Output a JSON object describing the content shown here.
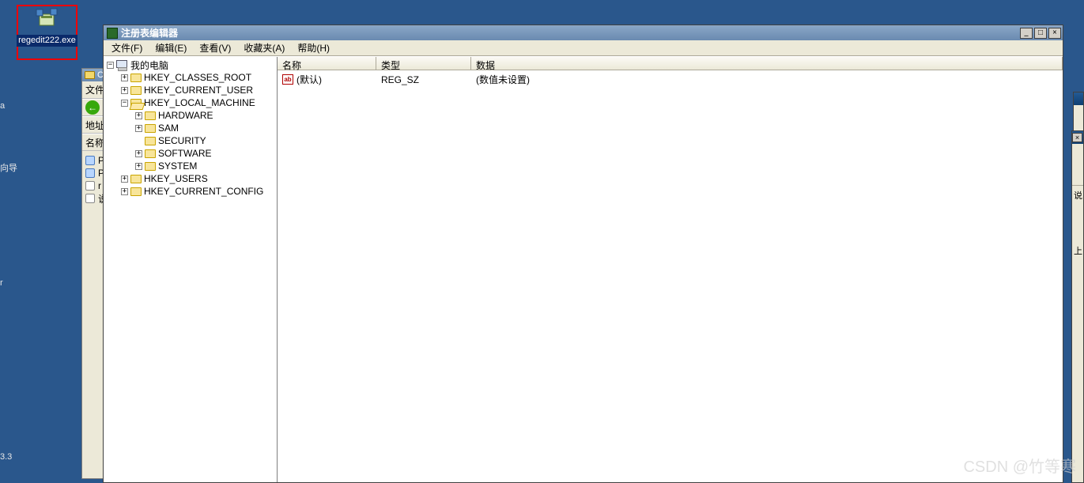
{
  "desktop_icon": {
    "label": "regedit222.exe"
  },
  "left_texts": {
    "a": "向导",
    "b": "3.3"
  },
  "bgwin": {
    "title": "C",
    "toolbar_file": "文件",
    "back_label": "后",
    "addr_label": "地址",
    "name_label": "名称",
    "rows": [
      "P",
      "P",
      "r",
      "说"
    ]
  },
  "regedit": {
    "title": "注册表编辑器",
    "menu": {
      "file": "文件(F)",
      "edit": "编辑(E)",
      "view": "查看(V)",
      "fav": "收藏夹(A)",
      "help": "帮助(H)"
    },
    "tree": {
      "root": "我的电脑",
      "nodes": [
        {
          "name": "HKEY_CLASSES_ROOT",
          "expanded": false,
          "depth": 1
        },
        {
          "name": "HKEY_CURRENT_USER",
          "expanded": false,
          "depth": 1
        },
        {
          "name": "HKEY_LOCAL_MACHINE",
          "expanded": true,
          "depth": 1
        },
        {
          "name": "HARDWARE",
          "expanded": false,
          "depth": 2
        },
        {
          "name": "SAM",
          "expanded": false,
          "depth": 2
        },
        {
          "name": "SECURITY",
          "expanded": null,
          "depth": 2
        },
        {
          "name": "SOFTWARE",
          "expanded": false,
          "depth": 2
        },
        {
          "name": "SYSTEM",
          "expanded": false,
          "depth": 2
        },
        {
          "name": "HKEY_USERS",
          "expanded": false,
          "depth": 1
        },
        {
          "name": "HKEY_CURRENT_CONFIG",
          "expanded": false,
          "depth": 1
        }
      ]
    },
    "columns": {
      "name": "名称",
      "type": "类型",
      "data": "数据"
    },
    "values": [
      {
        "name": "(默认)",
        "type": "REG_SZ",
        "data": "(数值未设置)"
      }
    ]
  },
  "sliver2": {
    "labels": [
      "说",
      "上"
    ]
  },
  "watermark": "CSDN @竹等寒"
}
